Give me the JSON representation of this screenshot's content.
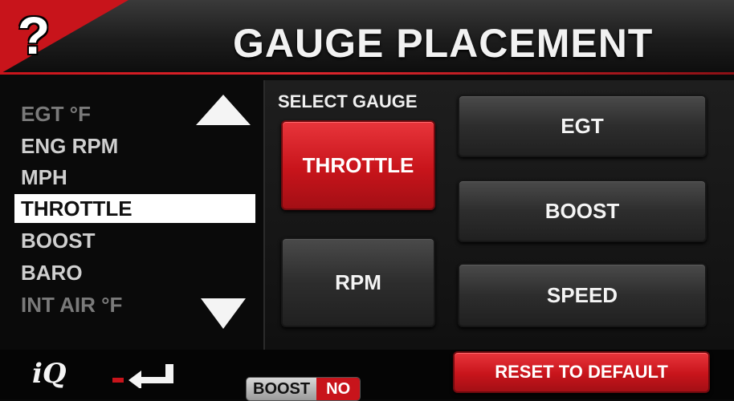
{
  "header": {
    "help_label": "?",
    "title": "GAUGE PLACEMENT"
  },
  "list": {
    "items": [
      {
        "label": "EGT °F",
        "state": "faded"
      },
      {
        "label": "ENG RPM",
        "state": "normal"
      },
      {
        "label": "MPH",
        "state": "normal"
      },
      {
        "label": "THROTTLE",
        "state": "selected"
      },
      {
        "label": "BOOST",
        "state": "normal"
      },
      {
        "label": "BARO",
        "state": "normal"
      },
      {
        "label": "INT AIR °F",
        "state": "faded"
      }
    ]
  },
  "select_gauge": {
    "label": "SELECT GAUGE",
    "buttons": [
      {
        "label": "THROTTLE",
        "active": true
      },
      {
        "label": "RPM",
        "active": false
      },
      {
        "label": "EGT",
        "active": false
      },
      {
        "label": "BOOST",
        "active": false
      },
      {
        "label": "SPEED",
        "active": false
      }
    ]
  },
  "footer": {
    "logo": "iQ",
    "status_label": "BOOST",
    "status_value": "NO",
    "reset_label": "RESET TO DEFAULT"
  },
  "colors": {
    "accent_red": "#c8141b",
    "background": "#0a0a0a",
    "button_gray": "#2d2d2d"
  },
  "icons": [
    "help-icon",
    "arrow-up-icon",
    "arrow-down-icon",
    "back-enter-icon"
  ]
}
